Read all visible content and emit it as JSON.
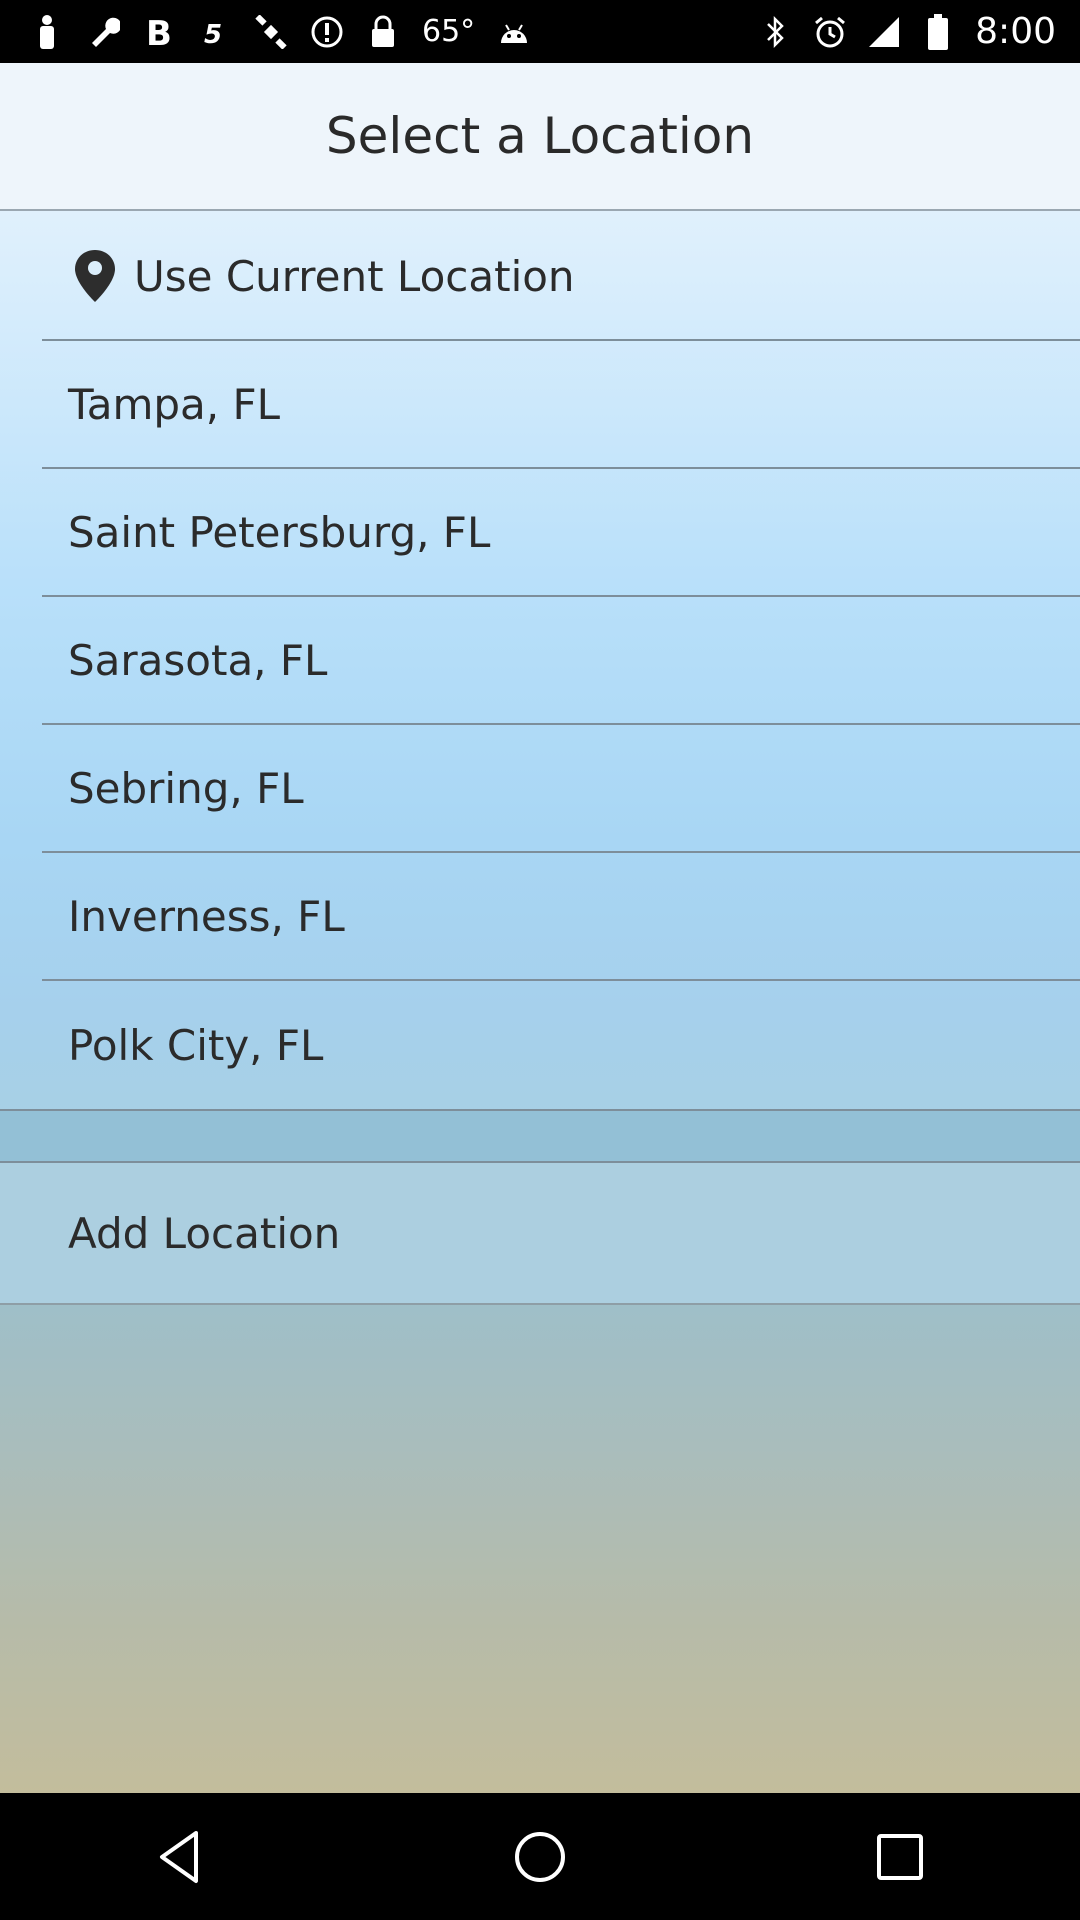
{
  "status_bar": {
    "temperature": "65°",
    "time": "8:00",
    "left_icons": [
      "person-icon",
      "wrench-icon",
      "bold-b-icon",
      "s-app-icon",
      "satellite-icon",
      "alert-circle-icon",
      "lock-icon",
      "temperature-text",
      "android-icon"
    ],
    "right_icons": [
      "bluetooth-icon",
      "alarm-icon",
      "signal-icon",
      "battery-icon"
    ]
  },
  "header": {
    "title": "Select a Location"
  },
  "locations": {
    "current": "Use Current Location",
    "items": [
      "Tampa, FL",
      "Saint Petersburg, FL",
      "Sarasota, FL",
      "Sebring, FL",
      "Inverness, FL",
      "Polk City, FL"
    ]
  },
  "add_location": {
    "label": "Add Location"
  },
  "nav": {
    "icons": [
      "back-icon",
      "home-icon",
      "recents-icon"
    ]
  },
  "colors": {
    "header_bg": "#eef5fb",
    "divider": "#7d8e9a",
    "text": "#2b2b2b"
  }
}
